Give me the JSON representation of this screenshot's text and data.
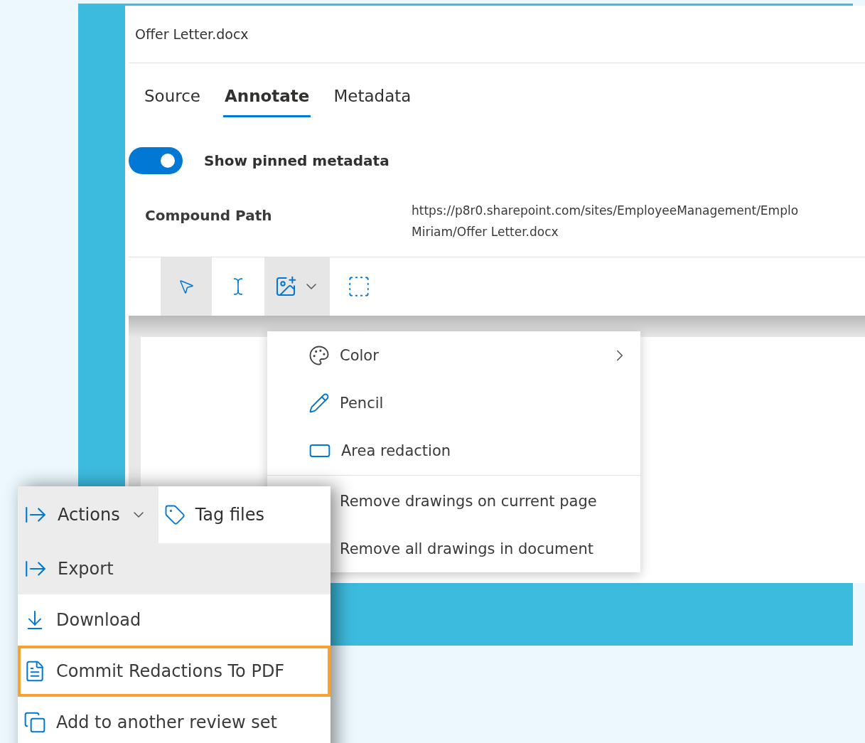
{
  "window": {
    "title": "Offer Letter.docx"
  },
  "tabs": [
    {
      "label": "Source",
      "selected": false
    },
    {
      "label": "Annotate",
      "selected": true
    },
    {
      "label": "Metadata",
      "selected": false
    }
  ],
  "toggle": {
    "label": "Show pinned metadata",
    "on": true
  },
  "fields": [
    {
      "label": "Compound Path",
      "lines": [
        "https://p8r0.sharepoint.com/sites/EmployeeManagement/Emplo",
        "Miriam/Offer Letter.docx"
      ]
    }
  ],
  "toolbar": [
    {
      "kind": "select",
      "selected": true
    },
    {
      "kind": "text",
      "selected": false
    },
    {
      "kind": "draw",
      "selected": true
    },
    {
      "kind": "area",
      "selected": false
    }
  ],
  "drawing_menu": [
    {
      "kind": "palette",
      "label": "Color",
      "submenu": true
    },
    {
      "kind": "pencil",
      "label": "Pencil",
      "submenu": false
    },
    {
      "kind": "rectangle",
      "label": "Area redaction",
      "submenu": false
    },
    {
      "kind": "divider"
    },
    {
      "kind": "plain",
      "label": "Remove drawings on current page",
      "submenu": false
    },
    {
      "kind": "plain",
      "label": "Remove all drawings in document",
      "submenu": false
    }
  ],
  "actions_menu": {
    "button": "Actions",
    "secondary": "Tag files",
    "items": [
      {
        "kind": "export",
        "label": "Export",
        "selected": true,
        "highlighted": false
      },
      {
        "kind": "download",
        "label": "Download",
        "selected": false,
        "highlighted": false
      },
      {
        "kind": "pdf",
        "label": "Commit Redactions To PDF",
        "selected": false,
        "highlighted": true
      },
      {
        "kind": "copy",
        "label": "Add to another review set",
        "selected": false,
        "highlighted": false
      }
    ]
  }
}
